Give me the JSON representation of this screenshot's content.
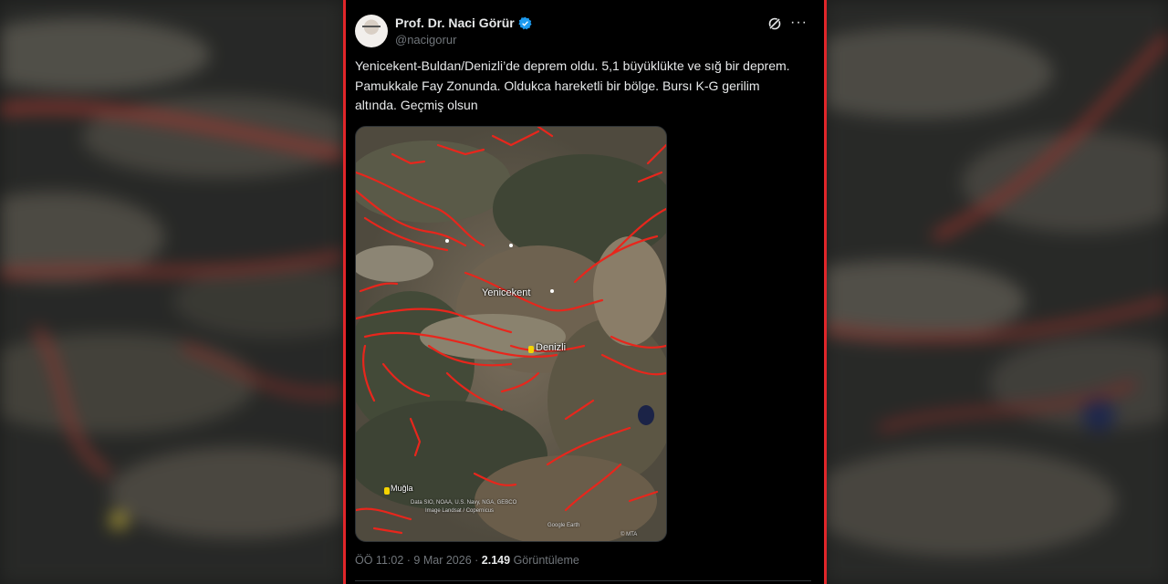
{
  "tweet": {
    "author_name": "Prof. Dr. Naci Görür",
    "handle": "@nacigorur",
    "text": "Yenicekent-Buldan/Denizli’de deprem oldu. 5,1 büyüklükte ve sığ bir deprem. Pamukkale Fay Zonunda. Oldukca hareketli bir bölge. Bursı K-G gerilim altında. Geçmiş olsun",
    "time": "ÖÖ 11:02",
    "separator": "·",
    "date": "9 Mar 2026",
    "views_count": "2.149",
    "views_label": "Görüntüleme"
  },
  "icons": {
    "verified": "verified-badge-icon",
    "grok": "grok-icon",
    "more": "more-icon"
  },
  "map": {
    "labels": {
      "yenicekent": "Yenicekent",
      "buldan": "Denizli",
      "mugla": "Muğla"
    },
    "credit_line1": "Data SIO, NOAA, U.S. Navy, NGA, GEBCO",
    "credit_line2": "Image Landsat / Copernicus",
    "credit_right": "Google Earth",
    "credit_logo": "© MTA"
  },
  "colors": {
    "fault_lines": "#e8261c",
    "frame_border": "#e0262a",
    "verified_blue": "#1d9bf0"
  }
}
